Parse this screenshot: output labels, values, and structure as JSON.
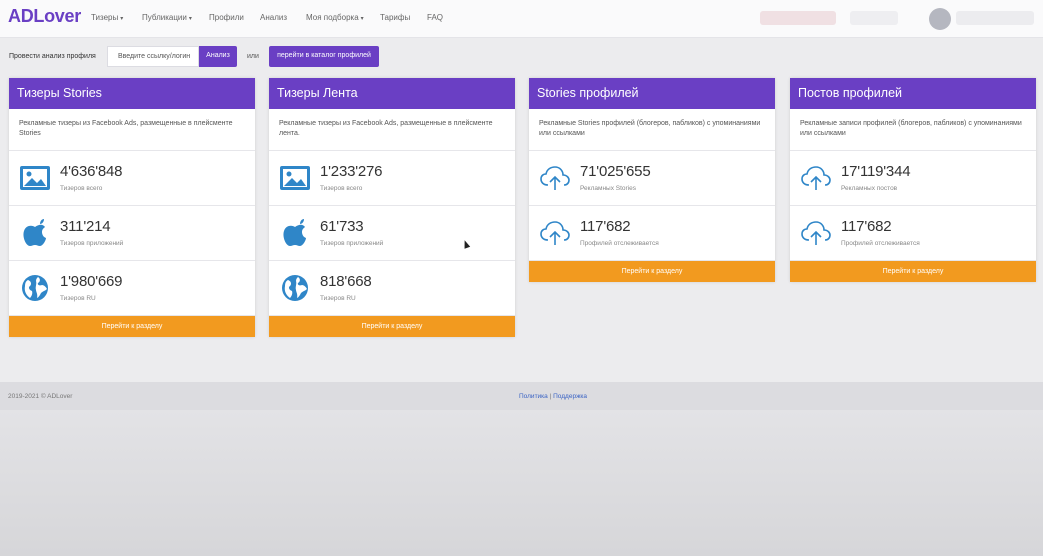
{
  "brand": {
    "logo": "ADLover",
    "accent": "#6a3fc4",
    "button_orange": "#f29a1f"
  },
  "nav": {
    "items": [
      {
        "label": "Тизеры",
        "caret": true
      },
      {
        "label": "Публикации",
        "caret": true
      },
      {
        "label": "Профили",
        "caret": false
      },
      {
        "label": "Анализ",
        "caret": false
      },
      {
        "label": "Моя подборка",
        "caret": true
      },
      {
        "label": "Тарифы",
        "caret": false
      },
      {
        "label": "FAQ",
        "caret": false
      }
    ],
    "caret_glyph": "▾"
  },
  "analysis": {
    "label": "Провести анализ профиля",
    "input_placeholder": "Введите ссылку/логин",
    "analyze_button": "Анализ",
    "or_text": "или",
    "catalog_button": "перейти в каталог профилей"
  },
  "cards": [
    {
      "title": "Тизеры Stories",
      "description": "Рекламные тизеры из Facebook Ads, размещенные в плейсменте Stories",
      "stats": [
        {
          "icon": "image-icon",
          "value": "4'636'848",
          "label": "Тизеров всего"
        },
        {
          "icon": "apple-icon",
          "value": "311'214",
          "label": "Тизеров приложений"
        },
        {
          "icon": "globe-icon",
          "value": "1'980'669",
          "label": "Тизеров RU"
        }
      ],
      "button": "Перейти к разделу"
    },
    {
      "title": "Тизеры Лента",
      "description": "Рекламные тизеры из Facebook Ads, размещенные в плейсменте лента.",
      "stats": [
        {
          "icon": "image-icon",
          "value": "1'233'276",
          "label": "Тизеров всего"
        },
        {
          "icon": "apple-icon",
          "value": "61'733",
          "label": "Тизеров приложений"
        },
        {
          "icon": "globe-icon",
          "value": "818'668",
          "label": "Тизеров RU"
        }
      ],
      "button": "Перейти к разделу"
    },
    {
      "title": "Stories профилей",
      "description": "Рекламные Stories профилей (блогеров, пабликов) с упоминаниями или ссылками",
      "stats": [
        {
          "icon": "cloud-upload-icon",
          "value": "71'025'655",
          "label": "Рекламных Stories"
        },
        {
          "icon": "cloud-upload-icon",
          "value": "117'682",
          "label": "Профилей отслеживается"
        }
      ],
      "button": "Перейти к разделу"
    },
    {
      "title": "Постов профилей",
      "description": "Рекламные записи профилей (блогеров, пабликов) с упоминаниями или ссылками",
      "stats": [
        {
          "icon": "cloud-upload-icon",
          "value": "17'119'344",
          "label": "Рекламных постов"
        },
        {
          "icon": "cloud-upload-icon",
          "value": "117'682",
          "label": "Профилей отслеживается"
        }
      ],
      "button": "Перейти к разделу"
    }
  ],
  "footer": {
    "copyright": "2019-2021 © ADLover",
    "link_policy": "Политика",
    "separator": "|",
    "link_support": "Поддержка"
  }
}
